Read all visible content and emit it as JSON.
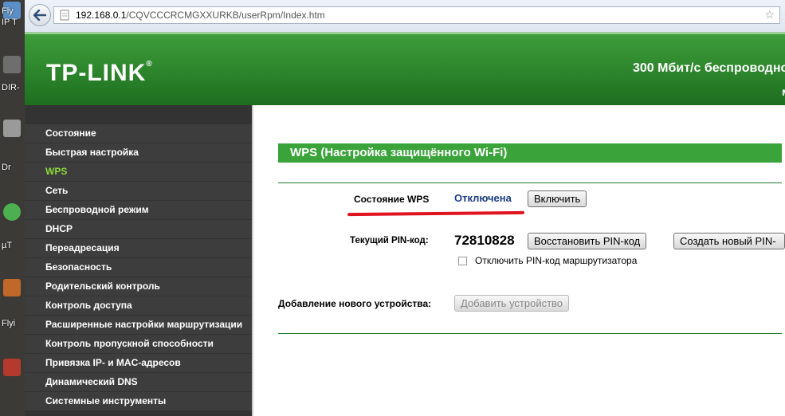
{
  "browser": {
    "url_host": "192.168.0.1",
    "url_path": "/CQVCCCRCMGXXURKB/userRpm/Index.htm"
  },
  "desktop": {
    "labels": [
      "Fly",
      "IP T",
      "DIR-",
      "Dr",
      "µT",
      "Flyi"
    ]
  },
  "header": {
    "logo": "TP-LINK",
    "product": "300 Мбит/с беспроводно",
    "model": "м"
  },
  "sidebar": {
    "items": [
      {
        "label": "Состояние"
      },
      {
        "label": "Быстрая настройка"
      },
      {
        "label": "WPS",
        "active": true
      },
      {
        "label": "Сеть"
      },
      {
        "label": "Беспроводной режим"
      },
      {
        "label": "DHCP"
      },
      {
        "label": "Переадресация"
      },
      {
        "label": "Безопасность"
      },
      {
        "label": "Родительский контроль"
      },
      {
        "label": "Контроль доступа"
      },
      {
        "label": "Расширенные настройки маршрутизации"
      },
      {
        "label": "Контроль пропускной способности"
      },
      {
        "label": "Привязка IP- и MAC-адресов"
      },
      {
        "label": "Динамический DNS"
      },
      {
        "label": "Системные инструменты"
      }
    ]
  },
  "main": {
    "title": "WPS (Настройка защищённого Wi-Fi)",
    "wps_status_label": "Состояние WPS",
    "wps_status_value": "Отключена",
    "enable_button": "Включить",
    "pin_label": "Текущий PIN-код:",
    "pin_value": "72810828",
    "restore_pin_button": "Восстановить PIN-код",
    "new_pin_button": "Создать новый PIN-",
    "disable_pin_checkbox_label": "Отключить PIN-код маршрутизатора",
    "disable_pin_checked": false,
    "add_device_label": "Добавление нового устройства:",
    "add_device_button": "Добавить устройство"
  },
  "colors": {
    "header_green": "#2a8a2a",
    "title_bar_green": "#3aa33a",
    "menu_active": "#8fd93a",
    "status_blue": "#1c3c86",
    "annotation_red": "#e0141e"
  }
}
